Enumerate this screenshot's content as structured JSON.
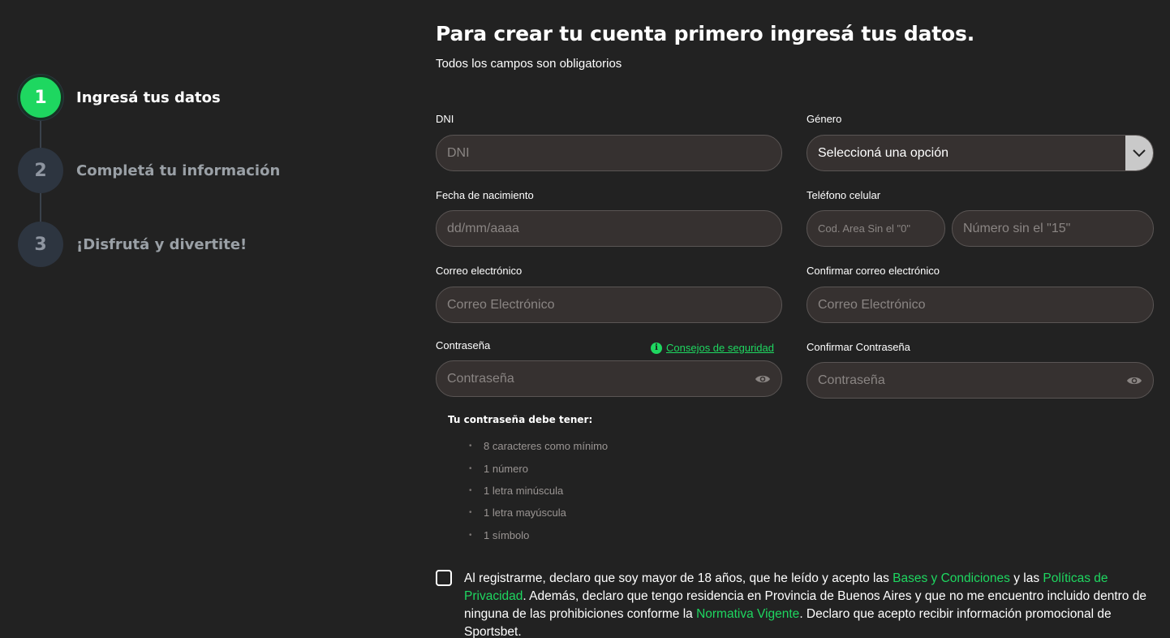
{
  "stepper": {
    "steps": [
      {
        "number": "1",
        "label": "Ingresá tus datos"
      },
      {
        "number": "2",
        "label": "Completá tu información"
      },
      {
        "number": "3",
        "label": "¡Disfrutá y divertite!"
      }
    ]
  },
  "header": {
    "title": "Para crear tu cuenta primero ingresá tus datos.",
    "subtitle": "Todos los campos son obligatorios"
  },
  "form": {
    "dni": {
      "label": "DNI",
      "placeholder": "DNI"
    },
    "gender": {
      "label": "Género",
      "value": "Seleccioná una opción"
    },
    "birthdate": {
      "label": "Fecha de nacimiento",
      "placeholder": "dd/mm/aaaa"
    },
    "phone": {
      "label": "Teléfono celular",
      "area_placeholder": "Cod. Area Sin el \"0\"",
      "number_placeholder": "Número sin el  \"15\""
    },
    "email": {
      "label": "Correo electrónico",
      "placeholder": "Correo Electrónico"
    },
    "email_confirm": {
      "label": "Confirmar correo electrónico",
      "placeholder": "Correo Electrónico"
    },
    "password": {
      "label": "Contraseña",
      "placeholder": "Contraseña",
      "security_link": "Consejos de seguridad"
    },
    "password_confirm": {
      "label": "Confirmar Contraseña",
      "placeholder": "Contraseña"
    }
  },
  "requirements": {
    "title": "Tu contraseña debe tener:",
    "items": [
      "8 caracteres como mínimo",
      "1 número",
      "1 letra minúscula",
      "1 letra mayúscula",
      "1 símbolo"
    ]
  },
  "terms": {
    "t1": "Al registrarme, declaro que soy mayor de 18 años, que he leído y acepto las ",
    "link1": "Bases y Condiciones",
    "t2": " y las ",
    "link2": "Políticas de Privacidad",
    "t3": ". Además, declaro que tengo residencia en Provincia de Buenos Aires y que no me encuentro incluido dentro de ninguna de las prohibiciones conforme la ",
    "link3": "Normativa Vigente",
    "t4": ". Declaro que acepto recibir información promocional de Sportsbet."
  },
  "colors": {
    "accent": "#1ed760",
    "background": "#222222",
    "field_bg": "#363130"
  }
}
